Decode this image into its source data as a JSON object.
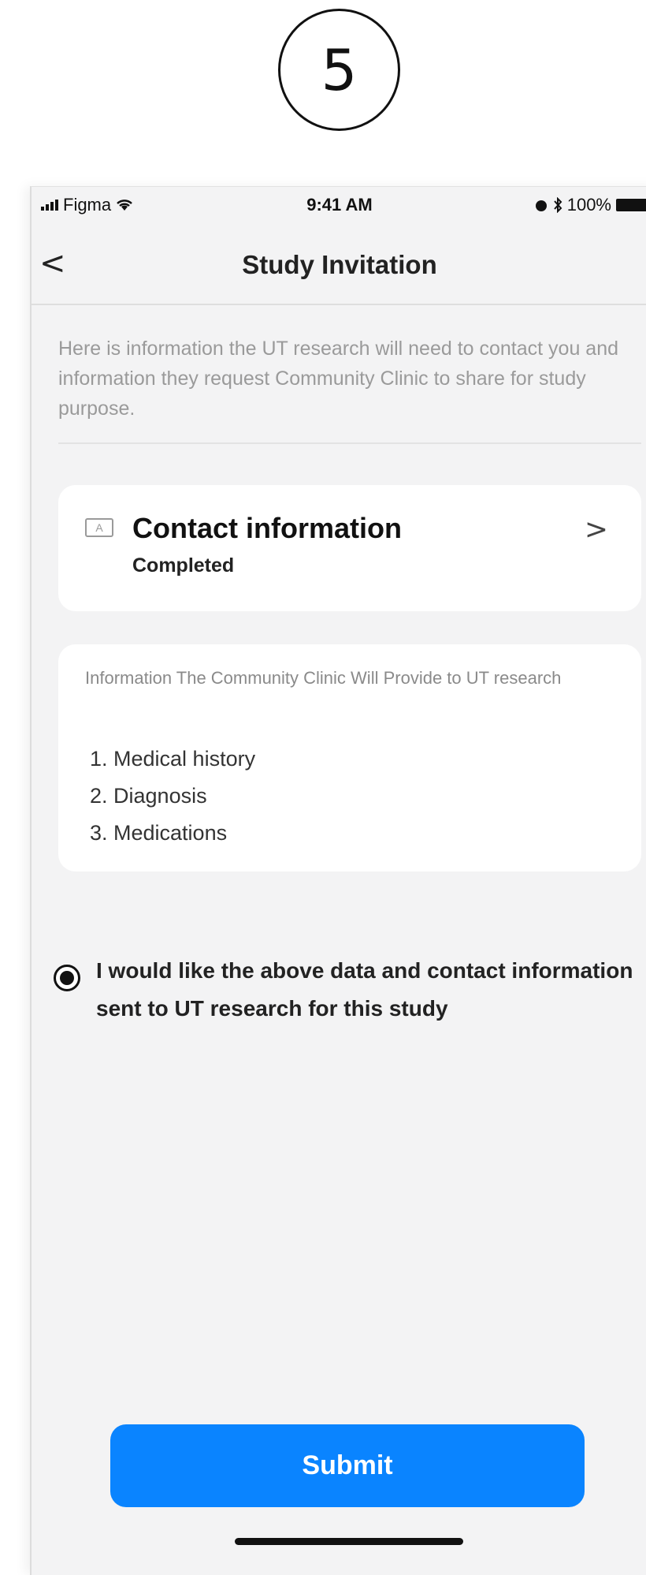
{
  "step_number": "5",
  "status_bar": {
    "carrier": "Figma",
    "time": "9:41 AM",
    "battery": "100%"
  },
  "nav": {
    "back_glyph": "<",
    "title": "Study Invitation"
  },
  "intro_text": "Here is information the UT research will need to contact you and information they request Community Clinic to share for study purpose.",
  "contact_card": {
    "icon": "id-card-icon",
    "title": "Contact information",
    "status": "Completed",
    "chevron": ">"
  },
  "provide_card": {
    "heading": "Information The Community Clinic Will Provide to UT research",
    "items": [
      "1. Medical history",
      "2. Diagnosis",
      "3. Medications"
    ]
  },
  "consent": {
    "selected": true,
    "text": "I would like the above data and contact information sent to UT research for this study"
  },
  "submit_label": "Submit",
  "colors": {
    "accent": "#0a84ff",
    "background": "#f3f3f4",
    "card": "#ffffff"
  }
}
